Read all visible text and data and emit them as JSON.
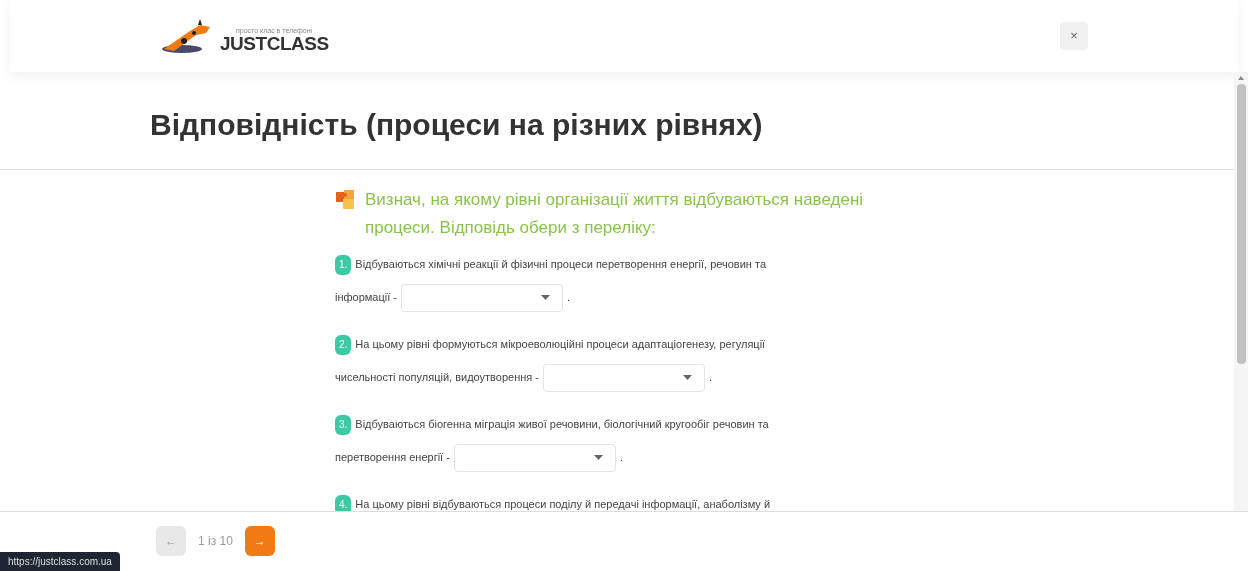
{
  "header": {
    "logo_tagline": "просто клас в телефоні",
    "logo_text": "JUSTCLASS",
    "close_label": "×"
  },
  "title": "Відповідність (процеси на різних рівнях)",
  "task": {
    "instruction": "Визнач, на якому рівні організації життя відбуваються наведені процеси. Відповідь обери з переліку:",
    "questions": [
      {
        "number": "1.",
        "lines": [
          "Відбуваються хімічні реакції й фізичні процеси перетворення енергії, речовин та",
          "інформації -"
        ],
        "after": "."
      },
      {
        "number": "2.",
        "lines": [
          "На цьому рівні формуються мікроеволюційні процеси адаптаціогенезу, регуляції",
          "чисельності популяцій, видоутворення -"
        ],
        "after": "."
      },
      {
        "number": "3.",
        "lines": [
          "Відбуваються біогенна міграція живої речовини, біологічний кругообіг речовин та",
          "перетворення енергії -"
        ],
        "after": "."
      },
      {
        "number": "4.",
        "lines": [
          "На цьому рівні відбуваються процеси поділу й передачі інформації, анаболізму й"
        ]
      }
    ]
  },
  "pager": {
    "prev_label": "←",
    "prev_disabled": true,
    "position": "1 із 10",
    "next_label": "→",
    "next_disabled": false
  },
  "status_url": "https://justclass.com.ua"
}
